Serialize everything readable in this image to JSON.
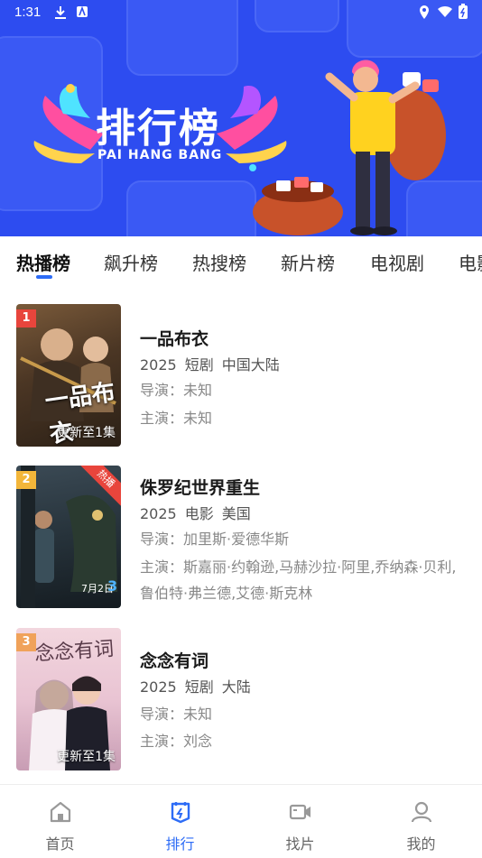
{
  "status_bar": {
    "time": "1:31"
  },
  "banner": {
    "title": "排行榜",
    "subtitle": "PAI HANG BANG"
  },
  "tabs": [
    {
      "label": "热播榜",
      "active": true
    },
    {
      "label": "飙升榜"
    },
    {
      "label": "热搜榜"
    },
    {
      "label": "新片榜"
    },
    {
      "label": "电视剧"
    },
    {
      "label": "电影"
    }
  ],
  "items": [
    {
      "rank": "1",
      "rank_color": "#e8453c",
      "title": "一品布衣",
      "year": "2025",
      "type": "短剧",
      "region": "中国大陆",
      "director": "导演：未知",
      "cast": "主演：未知",
      "poster_caption": "更新至1集",
      "poster_title": "一品布衣"
    },
    {
      "rank": "2",
      "rank_color": "#f3b63a",
      "title": "侏罗纪世界重生",
      "year": "2025",
      "type": "电影",
      "region": "美国",
      "director": "导演：加里斯·爱德华斯",
      "cast": "主演：斯嘉丽·约翰逊,马赫沙拉·阿里,乔纳森·贝利,鲁伯特·弗兰德,艾德·斯克林",
      "badge": "热播",
      "poster_date": "7月2日",
      "poster_num": "3"
    },
    {
      "rank": "3",
      "rank_color": "#f0a25a",
      "title": "念念有词",
      "year": "2025",
      "type": "短剧",
      "region": "大陆",
      "director": "导演：未知",
      "cast": "主演：刘念",
      "poster_caption": "更新至1集",
      "poster_title": "念念有词"
    }
  ],
  "bottom_nav": [
    {
      "label": "首页",
      "icon": "home-icon"
    },
    {
      "label": "排行",
      "icon": "ranking-icon",
      "active": true
    },
    {
      "label": "找片",
      "icon": "video-icon"
    },
    {
      "label": "我的",
      "icon": "user-icon"
    }
  ],
  "colors": {
    "accent": "#2d6cf6",
    "banner_bg": "#2d4cf0"
  }
}
